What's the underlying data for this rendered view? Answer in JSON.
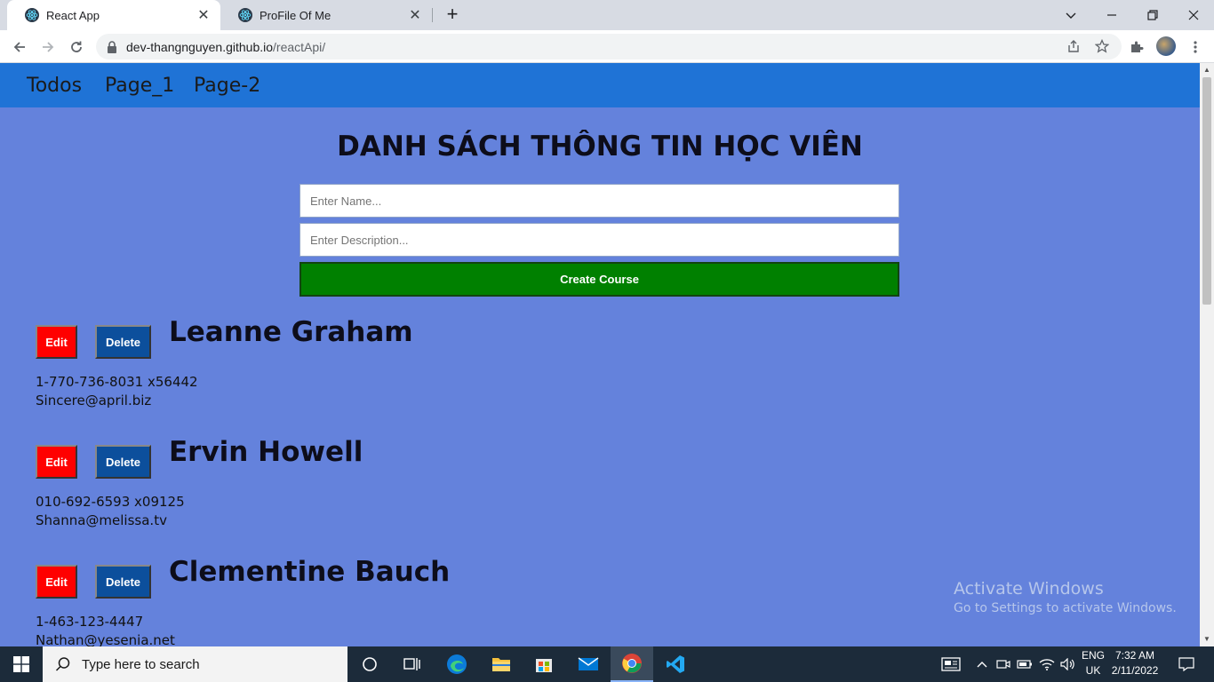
{
  "browser": {
    "tabs": [
      {
        "title": "React App",
        "active": true
      },
      {
        "title": "ProFile Of Me",
        "active": false
      }
    ],
    "new_tab": "+",
    "address": {
      "domain": "dev-thangnguyen.github.io",
      "path": "/reactApi/"
    }
  },
  "navbar": {
    "links": [
      "Todos",
      "Page_1",
      "Page-2"
    ]
  },
  "main": {
    "heading": "DANH SÁCH THÔNG TIN HỌC VIÊN",
    "name_placeholder": "Enter Name...",
    "description_placeholder": "Enter Description...",
    "create_button": "Create Course"
  },
  "people": [
    {
      "name": "Leanne Graham",
      "phone": "1-770-736-8031 x56442",
      "email": "Sincere@april.biz",
      "edit": "Edit",
      "delete": "Delete"
    },
    {
      "name": "Ervin Howell",
      "phone": "010-692-6593 x09125",
      "email": "Shanna@melissa.tv",
      "edit": "Edit",
      "delete": "Delete"
    },
    {
      "name": "Clementine Bauch",
      "phone": "1-463-123-4447",
      "email": "Nathan@yesenia.net",
      "edit": "Edit",
      "delete": "Delete"
    }
  ],
  "watermark": {
    "line1": "Activate Windows",
    "line2": "Go to Settings to activate Windows."
  },
  "taskbar": {
    "search_placeholder": "Type here to search",
    "language": {
      "line1": "ENG",
      "line2": "UK"
    },
    "clock": {
      "time": "7:32 AM",
      "date": "2/11/2022"
    }
  },
  "colors": {
    "page_bg": "#6482dc",
    "navbar_bg": "#1f73d6",
    "create_button": "#008000",
    "edit_button": "#ff0000",
    "delete_button": "#0c4f9c"
  }
}
